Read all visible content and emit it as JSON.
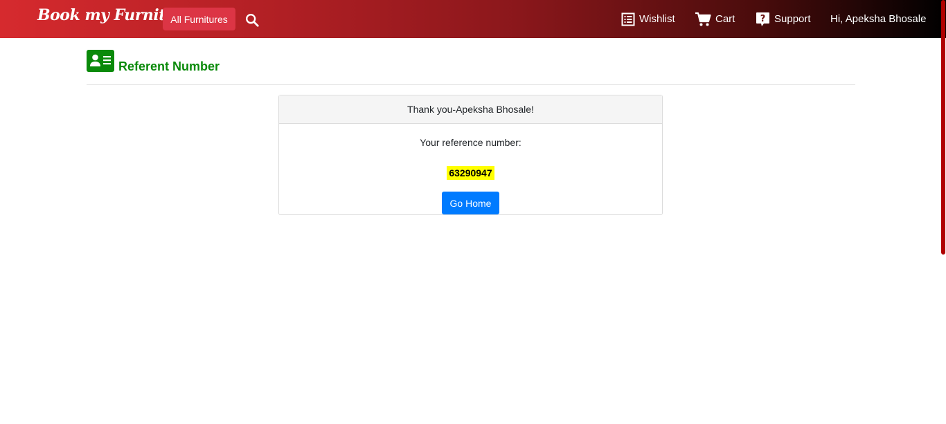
{
  "navbar": {
    "brand": "Book my Furniture",
    "all_button": "All Furnitures",
    "wishlist": "Wishlist",
    "cart": "Cart",
    "support": "Support",
    "user_greeting": "Hi, Apeksha Bhosale"
  },
  "page": {
    "title": "Referent Number"
  },
  "card": {
    "header": "Thank you-Apeksha Bhosale!",
    "ref_label": "Your reference number:",
    "ref_number": "63290947",
    "home_button": "Go Home"
  },
  "colors": {
    "title_green": "#0a8a0a",
    "button_blue": "#007bff",
    "highlight_yellow": "#ffff00",
    "nav_button_red": "#dc3545"
  },
  "icons": [
    "search-icon",
    "wishlist-icon",
    "cart-icon",
    "support-icon",
    "id-card-icon"
  ]
}
